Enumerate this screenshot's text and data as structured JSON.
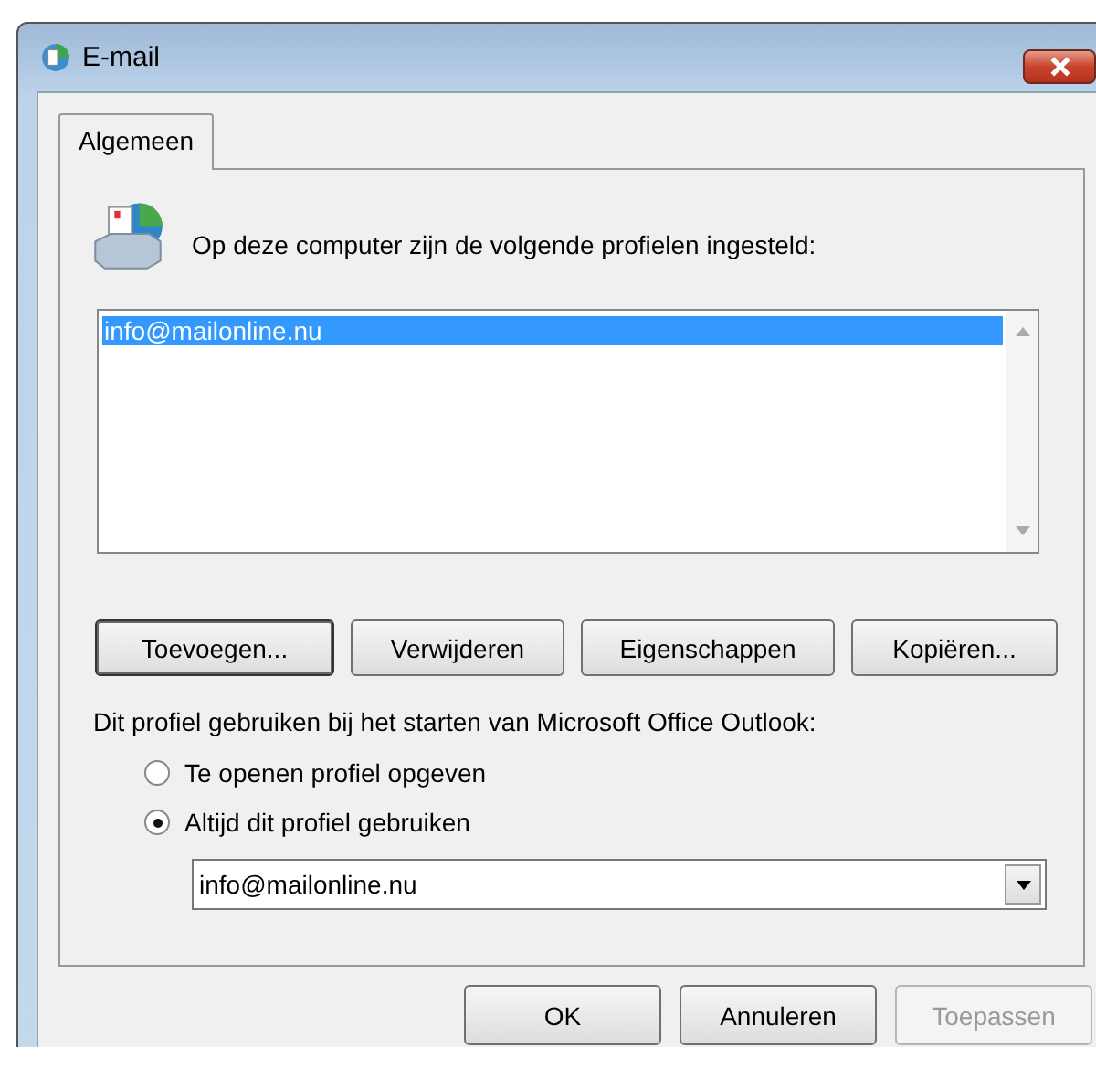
{
  "window": {
    "title": "E-mail"
  },
  "tabs": [
    {
      "label": "Algemeen",
      "selected": true
    }
  ],
  "intro": "Op deze computer zijn de volgende profielen ingesteld:",
  "profiles": [
    {
      "name": "info@mailonline.nu",
      "selected": true
    }
  ],
  "profile_buttons": [
    {
      "label": "Toevoegen...",
      "default": true
    },
    {
      "label": "Verwijderen",
      "default": false
    },
    {
      "label": "Eigenschappen",
      "default": false
    },
    {
      "label": "Kopiëren...",
      "default": false
    }
  ],
  "startup_label": "Dit profiel gebruiken bij het starten van Microsoft Office Outlook:",
  "options": [
    {
      "label": "Te openen profiel opgeven",
      "selected": false
    },
    {
      "label": "Altijd dit profiel gebruiken",
      "selected": true
    }
  ],
  "profile_select": {
    "value": "info@mailonline.nu"
  },
  "buttons": [
    {
      "label": "OK",
      "disabled": false
    },
    {
      "label": "Annuleren",
      "disabled": false
    },
    {
      "label": "Toepassen",
      "disabled": true
    }
  ]
}
